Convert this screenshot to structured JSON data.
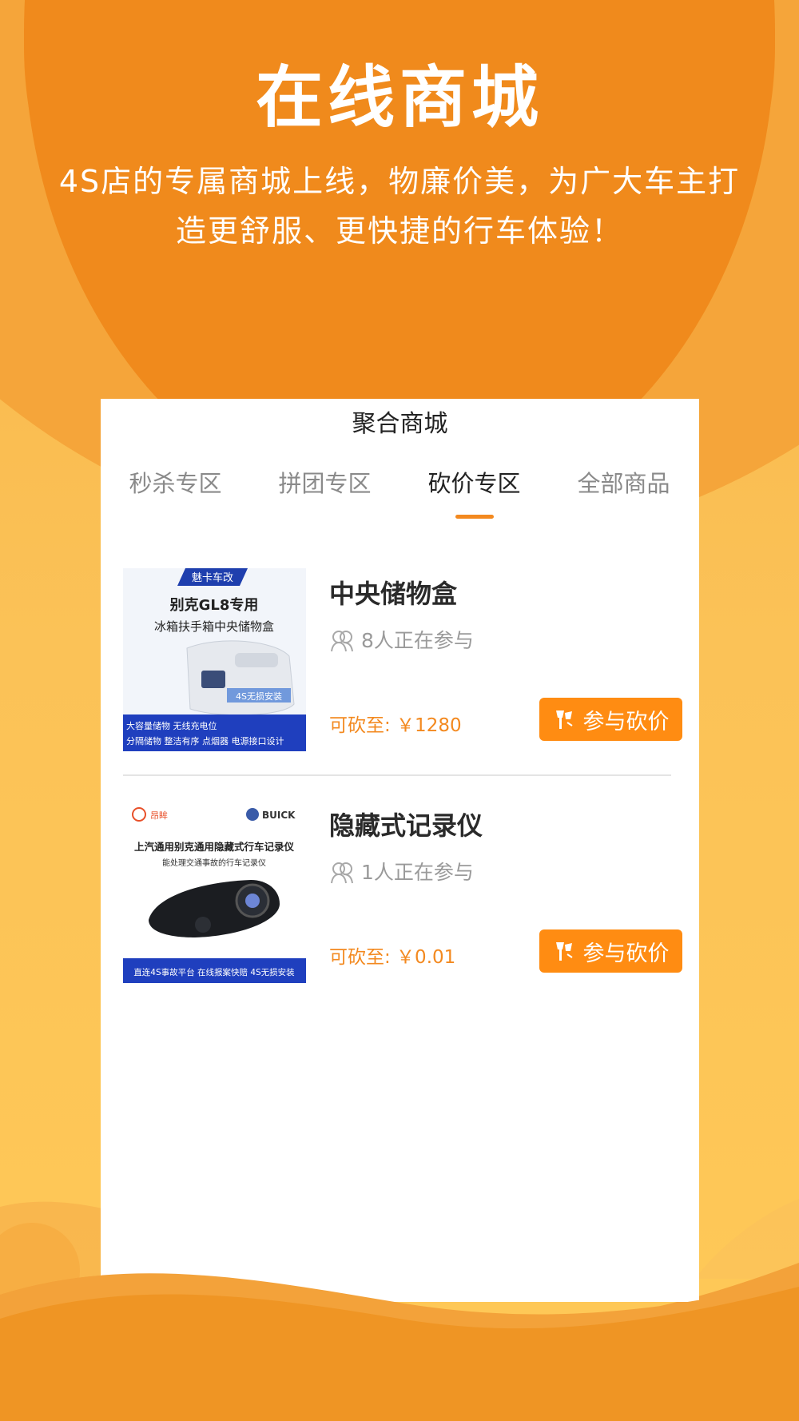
{
  "hero": {
    "title": "在线商城",
    "subtitle": "4S店的专属商城上线，物廉价美，为广大车主打造更舒服、更快捷的行车体验！"
  },
  "card": {
    "title": "聚合商城",
    "tabs": [
      {
        "label": "秒杀专区",
        "active": false
      },
      {
        "label": "拼团专区",
        "active": false
      },
      {
        "label": "砍价专区",
        "active": true
      },
      {
        "label": "全部商品",
        "active": false
      }
    ]
  },
  "products": [
    {
      "name": "中央储物盒",
      "participants": "8人正在参与",
      "price": "可砍至: ￥1280",
      "button": "参与砍价",
      "thumb": {
        "badge": "魅卡车改",
        "headline": "别克GL8专用",
        "subline": "冰箱扶手箱中央储物盒",
        "tag": "4S无损安装",
        "features_line1": "大容量储物 无线充电位",
        "features_line2": "分隔储物 整洁有序 点烟器 电源接口设计"
      }
    },
    {
      "name": "隐藏式记录仪",
      "participants": "1人正在参与",
      "price": "可砍至: ￥0.01",
      "button": "参与砍价",
      "thumb": {
        "brand_left": "昂眸",
        "brand_right": "BUICK",
        "headline": "上汽通用别克通用隐藏式行车记录仪",
        "subline": "能处理交通事故的行车记录仪",
        "footer": "直连4S事故平台 在线报案快赔 4S无损安装"
      }
    }
  ],
  "colors": {
    "accent": "#ff8c12",
    "price": "#f3891f",
    "hero_bg": "#f08a1c"
  }
}
